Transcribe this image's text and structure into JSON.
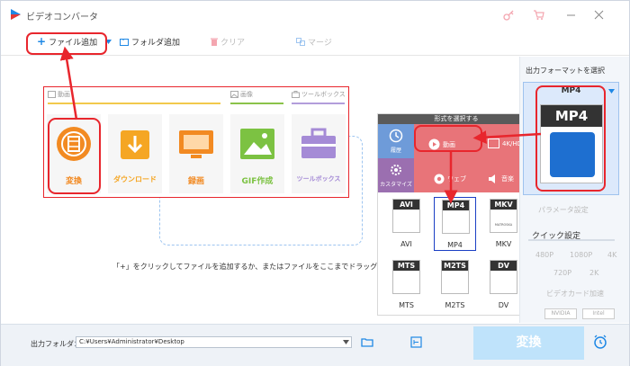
{
  "app": {
    "title": "ビデオコンバータ"
  },
  "toolbar": {
    "add_file": "ファイル追加",
    "add_folder": "フォルダ追加",
    "clear": "クリア",
    "merge": "マージ"
  },
  "categories": {
    "video": "動画",
    "image": "画像",
    "toolbox": "ツールボックス"
  },
  "tiles": [
    {
      "label": "変換"
    },
    {
      "label": "ダウンロード"
    },
    {
      "label": "録画"
    },
    {
      "label": "GIF作成"
    },
    {
      "label": "ツールボックス"
    }
  ],
  "hint": "「+」をクリックしてファイルを追加するか、またはファイルをここまでドラッグ",
  "popup": {
    "header": "形式を選択する",
    "side": [
      "履歴",
      "カスタマイズ"
    ],
    "types": [
      "動画",
      "4K/HD",
      "ウェブ",
      "音楽"
    ],
    "formats": [
      "AVI",
      "MP4",
      "MKV",
      "MTS",
      "M2TS",
      "DV"
    ],
    "mkv_sub": "MATROSKA"
  },
  "output": {
    "header": "出力フォーマットを選択",
    "format": "MP4",
    "card_tag": "MP4",
    "params": "パラメータ設定",
    "quick": "クイック設定",
    "res_top": [
      "480P",
      "1080P",
      "4K"
    ],
    "res_bottom": [
      "720P",
      "2K"
    ],
    "accel": "ビデオカード加速",
    "gpu": [
      "NVIDIA",
      "Intel"
    ]
  },
  "bottom": {
    "folder_label": "出力フォルダ：",
    "folder_path": "C:¥Users¥Administrator¥Desktop",
    "convert": "変換"
  },
  "colors": {
    "red_annotation": "#e8262d",
    "accent_blue": "#1e88e5",
    "convert_btn": "#bfe3fb"
  }
}
